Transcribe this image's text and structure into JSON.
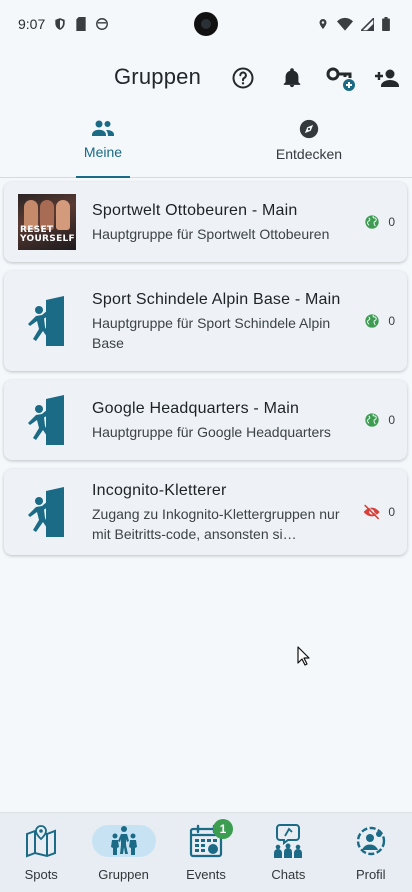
{
  "status_bar": {
    "time": "9:07"
  },
  "header": {
    "title": "Gruppen",
    "actions": [
      "help-icon",
      "bell-icon",
      "key-add-icon",
      "person-add-icon"
    ]
  },
  "tabs": [
    {
      "label": "Meine",
      "icon": "group-icon",
      "active": true
    },
    {
      "label": "Entdecken",
      "icon": "compass-icon",
      "active": false
    }
  ],
  "groups": [
    {
      "title": "Sportwelt Ottobeuren - Main",
      "description": "Hauptgruppe für Sportwelt Ottobeuren",
      "count": "0",
      "visibility": "public-globe-icon",
      "thumb": "photo",
      "thumb_text": "RESET YOURSELF"
    },
    {
      "title": "Sport Schindele Alpin Base - Main",
      "description": "Hauptgruppe für Sport Schindele Alpin Base",
      "count": "0",
      "visibility": "public-globe-icon",
      "thumb": "climber-icon"
    },
    {
      "title": "Google Headquarters - Main",
      "description": "Hauptgruppe für Google Headquarters",
      "count": "0",
      "visibility": "public-globe-icon",
      "thumb": "climber-icon"
    },
    {
      "title": "Incognito-Kletterer",
      "description": "Zugang zu Inkognito-Klettergruppen nur mit Beitritts-code, ansonsten si…",
      "count": "0",
      "visibility": "hidden-eye-off-icon",
      "thumb": "climber-icon"
    }
  ],
  "bottom_nav": [
    {
      "label": "Spots",
      "icon": "map-icon",
      "active": false
    },
    {
      "label": "Gruppen",
      "icon": "climbers-group-icon",
      "active": true
    },
    {
      "label": "Events",
      "icon": "calendar-icon",
      "active": false,
      "badge": "1"
    },
    {
      "label": "Chats",
      "icon": "chat-group-icon",
      "active": false
    },
    {
      "label": "Profil",
      "icon": "profile-gear-icon",
      "active": false
    }
  ],
  "colors": {
    "accent": "#1b6a86",
    "public_green": "#3c9d51",
    "hidden_red": "#d8413b",
    "nav_active_bg": "#c7e3f3",
    "climber_teal": "#1b6a86"
  }
}
